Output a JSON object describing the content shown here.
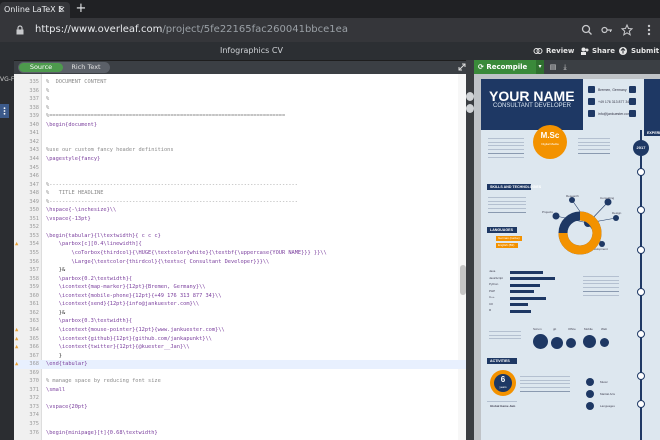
{
  "browser": {
    "tab_title": "Online LaTeX E",
    "tab_close": "×",
    "new_tab": "+",
    "url_host": "https://www.overleaf.com",
    "url_path": "/project/5fe22165fac260041bbce1ea",
    "icons": [
      "search-icon",
      "key-icon",
      "star-icon",
      "menu-icon"
    ]
  },
  "overleaf": {
    "doc_title": "Infographics CV",
    "review_label": "Review",
    "share_label": "Share",
    "submit_label": "Submit",
    "left_label": "VG-F"
  },
  "editor": {
    "mode_source": "Source",
    "mode_rich": "Rich Text",
    "lines": [
      {
        "n": "",
        "t": "%  DOCUMENT CONTENT",
        "k": "c-comment"
      },
      {
        "n": "",
        "t": "%",
        "k": "c-comment"
      },
      {
        "n": "",
        "t": "%",
        "k": "c-comment"
      },
      {
        "n": "",
        "t": "%",
        "k": "c-comment"
      },
      {
        "n": "",
        "t": "%==========================================================================",
        "k": "c-comment"
      },
      {
        "n": "",
        "t": "\\begin{document}",
        "k": "c-cmd"
      },
      {
        "n": "",
        "t": "",
        "k": "c-plain"
      },
      {
        "n": "",
        "t": "",
        "k": "c-plain"
      },
      {
        "n": "",
        "t": "%use our custom fancy header definitions",
        "k": "c-comment"
      },
      {
        "n": "",
        "t": "\\pagestyle{fancy}",
        "k": "c-cmd"
      },
      {
        "n": "",
        "t": "",
        "k": "c-plain"
      },
      {
        "n": "",
        "t": "",
        "k": "c-plain"
      },
      {
        "n": "",
        "t": "%------------------------------------------------------------------------------",
        "k": "c-comment"
      },
      {
        "n": "",
        "t": "%   TITLE HEADLINE",
        "k": "c-comment"
      },
      {
        "n": "",
        "t": "%------------------------------------------------------------------------------",
        "k": "c-comment"
      },
      {
        "n": "",
        "t": "\\hspace{-\\inchesize}\\\\",
        "k": "c-cmd"
      },
      {
        "n": "",
        "t": "\\vspace{-13pt}",
        "k": "c-cmd"
      },
      {
        "n": "",
        "t": "",
        "k": "c-plain"
      },
      {
        "n": "",
        "t": "\\begin{tabular}{l\\textwidth}{ c c c}",
        "k": "c-cmd"
      },
      {
        "n": "",
        "t": "    \\parbox[c][0.4\\linewidth]{",
        "k": "c-cmd"
      },
      {
        "n": "",
        "t": "        \\coTorbox{thirdcol}{\\HUGE{\\textcolor{white}{\\textbf{\\uppercase{YOUR NAME}}} }}\\\\",
        "k": "c-cmd"
      },
      {
        "n": "",
        "t": "        \\Large{\\textcolor{thirdcol}{\\textsc{ Consultant Developer}}}\\\\",
        "k": "c-cmd"
      },
      {
        "n": "",
        "t": "    }&",
        "k": "c-plain"
      },
      {
        "n": "",
        "t": "    \\parbox{0.2\\textwidth}{",
        "k": "c-cmd"
      },
      {
        "n": "",
        "t": "    \\icontext{map-marker}{12pt}{Bremen, Germany}\\\\",
        "k": "c-cmd"
      },
      {
        "n": "",
        "t": "    \\icontext{mobile-phone}{12pt}{+49 176 313 877 34}\\\\",
        "k": "c-cmd"
      },
      {
        "n": "",
        "t": "    \\icontext{send}{12pt}{info@jankuester.com}\\\\",
        "k": "c-cmd"
      },
      {
        "n": "",
        "t": "    }&",
        "k": "c-plain"
      },
      {
        "n": "",
        "t": "    \\parbox{0.3\\textwidth}{",
        "k": "c-cmd"
      },
      {
        "n": "",
        "t": "    \\icontext{mouse-pointer}{12pt}{www.jankuester.com}\\\\",
        "k": "c-cmd"
      },
      {
        "n": "",
        "t": "    \\icontext{github}{12pt}{github.com/jankapunkt}\\\\",
        "k": "c-cmd"
      },
      {
        "n": "",
        "t": "    \\icontext{twitter}{12pt}{@kuester__Jan}\\\\",
        "k": "c-cmd"
      },
      {
        "n": "",
        "t": "    }",
        "k": "c-plain"
      },
      {
        "n": "",
        "t": "\\end{tabular}",
        "k": "c-cmd"
      },
      {
        "n": "",
        "t": "",
        "k": "c-plain"
      },
      {
        "n": "",
        "t": "% manage space by reducing font size",
        "k": "c-comment"
      },
      {
        "n": "",
        "t": "\\small",
        "k": "c-cmd"
      },
      {
        "n": "",
        "t": "",
        "k": "c-plain"
      },
      {
        "n": "",
        "t": "\\vspace{20pt}",
        "k": "c-cmd"
      },
      {
        "n": "",
        "t": "",
        "k": "c-plain"
      },
      {
        "n": "",
        "t": "",
        "k": "c-plain"
      },
      {
        "n": "",
        "t": "\\begin{minipage}[t]{0.68\\textwidth}",
        "k": "c-cmd"
      }
    ],
    "line_numbers": [
      "335",
      "336",
      "337",
      "338",
      "339",
      "340",
      "341",
      "342",
      "343",
      "344",
      "345",
      "346",
      "347",
      "348",
      "349",
      "350",
      "351",
      "352",
      "353",
      "354",
      "355",
      "356",
      "357",
      "358",
      "359",
      "360",
      "361",
      "362",
      "363",
      "364",
      "365",
      "366",
      "367",
      "368",
      "369",
      "370",
      "371",
      "372",
      "373",
      "374",
      "375",
      "376"
    ],
    "numbered_from": "331"
  },
  "pdf": {
    "recompile_label": "Recompile",
    "name": "YOUR NAME",
    "role": "CONSULTANT DEVELOPER",
    "contact": [
      "Bremen, Germany",
      "+49 176 313 877 34",
      "info@jankuester.com"
    ],
    "degree": "M.Sc",
    "degree_sub": "Digital Media",
    "year": "2017",
    "skills_header": "SKILLS AND TECHNOLOGIES",
    "languages_header": "LANGUAGES",
    "lang_items": [
      "German (native)",
      "English (B2)"
    ],
    "skill_labels": [
      "Research",
      "Consulting",
      "Design",
      "Projects",
      "Development"
    ],
    "activities_header": "ACTIVITIES",
    "years": "6",
    "years_label": "years",
    "gamejam": "Global Game Jam",
    "bar_labels": [
      "Java",
      "JavaScript",
      "Python",
      "PHP",
      "C++",
      "C#",
      "R"
    ],
    "side_labels": [
      "Music",
      "Martial Arts",
      "Languages"
    ],
    "stat_labels": [
      "Scrum",
      "git",
      "Office",
      "Mobile",
      "Web"
    ],
    "experience_label": "EXPERIENCE"
  }
}
